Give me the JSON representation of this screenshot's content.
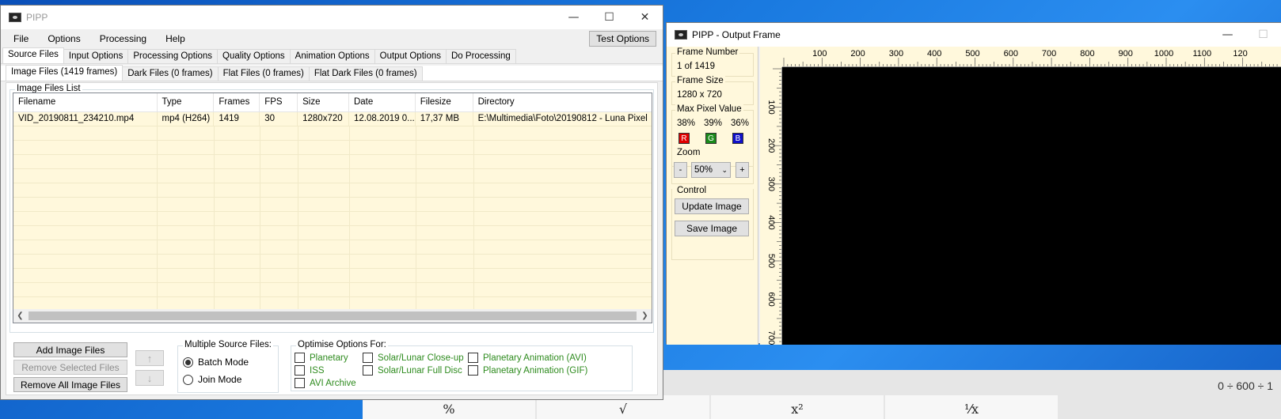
{
  "main_window": {
    "title": "PIPP",
    "menu": [
      "File",
      "Options",
      "Processing",
      "Help"
    ],
    "test_button": "Test Options",
    "tabs": [
      "Source Files",
      "Input Options",
      "Processing Options",
      "Quality Options",
      "Animation Options",
      "Output Options",
      "Do Processing"
    ],
    "subtabs": [
      "Image Files (1419 frames)",
      "Dark Files (0 frames)",
      "Flat Files (0 frames)",
      "Flat Dark Files (0 frames)"
    ],
    "group_label": "Image Files List",
    "columns": [
      "Filename",
      "Type",
      "Frames",
      "FPS",
      "Size",
      "Date",
      "Filesize",
      "Directory"
    ],
    "rows": [
      [
        "VID_20190811_234210.mp4",
        "mp4 (H264)",
        "1419",
        "30",
        "1280x720",
        "12.08.2019 0...",
        "17,37 MB",
        "E:\\Multimedia\\Foto\\20190812 - Luna Pixel"
      ]
    ],
    "buttons": {
      "add": "Add Image Files",
      "remove_selected": "Remove Selected Files",
      "remove_all": "Remove All Image Files",
      "up": "↑",
      "down": "↓"
    },
    "multiple_source": {
      "label": "Multiple Source Files:",
      "batch": "Batch Mode",
      "join": "Join Mode"
    },
    "optimise": {
      "label": "Optimise Options For:",
      "options": [
        "Planetary",
        "ISS",
        "AVI Archive",
        "Solar/Lunar Close-up",
        "Solar/Lunar Full Disc",
        "Planetary Animation (AVI)",
        "Planetary Animation (GIF)"
      ]
    }
  },
  "output_window": {
    "title": "PIPP - Output Frame",
    "frame_number_label": "Frame Number",
    "frame_number": "1 of 1419",
    "frame_size_label": "Frame Size",
    "frame_size": "1280 x 720",
    "max_pixel_label": "Max Pixel Value",
    "pixel_r": "38%",
    "pixel_g": "39%",
    "pixel_b": "36%",
    "r": "R",
    "g": "G",
    "b": "B",
    "zoom_label": "Zoom",
    "zoom_minus": "-",
    "zoom_value": "50%",
    "zoom_plus": "+",
    "control_label": "Control",
    "update_button": "Update Image",
    "save_button": "Save Image",
    "ruler_top": [
      "100",
      "200",
      "300",
      "400",
      "500",
      "600",
      "700",
      "800",
      "900",
      "1000",
      "1100",
      "120"
    ],
    "ruler_left": [
      "100",
      "200",
      "300",
      "400",
      "500",
      "600",
      "700"
    ]
  },
  "calculator": {
    "expression": "0 ÷ 600 ÷ 1",
    "keys": [
      "%",
      "√",
      "x²",
      "¹⁄x"
    ]
  },
  "colors": {
    "list_bg": "#fff8dc",
    "accent_green": "#2e8b1e",
    "r": "#e00000",
    "g": "#1a8a1a",
    "b": "#1010c8"
  }
}
